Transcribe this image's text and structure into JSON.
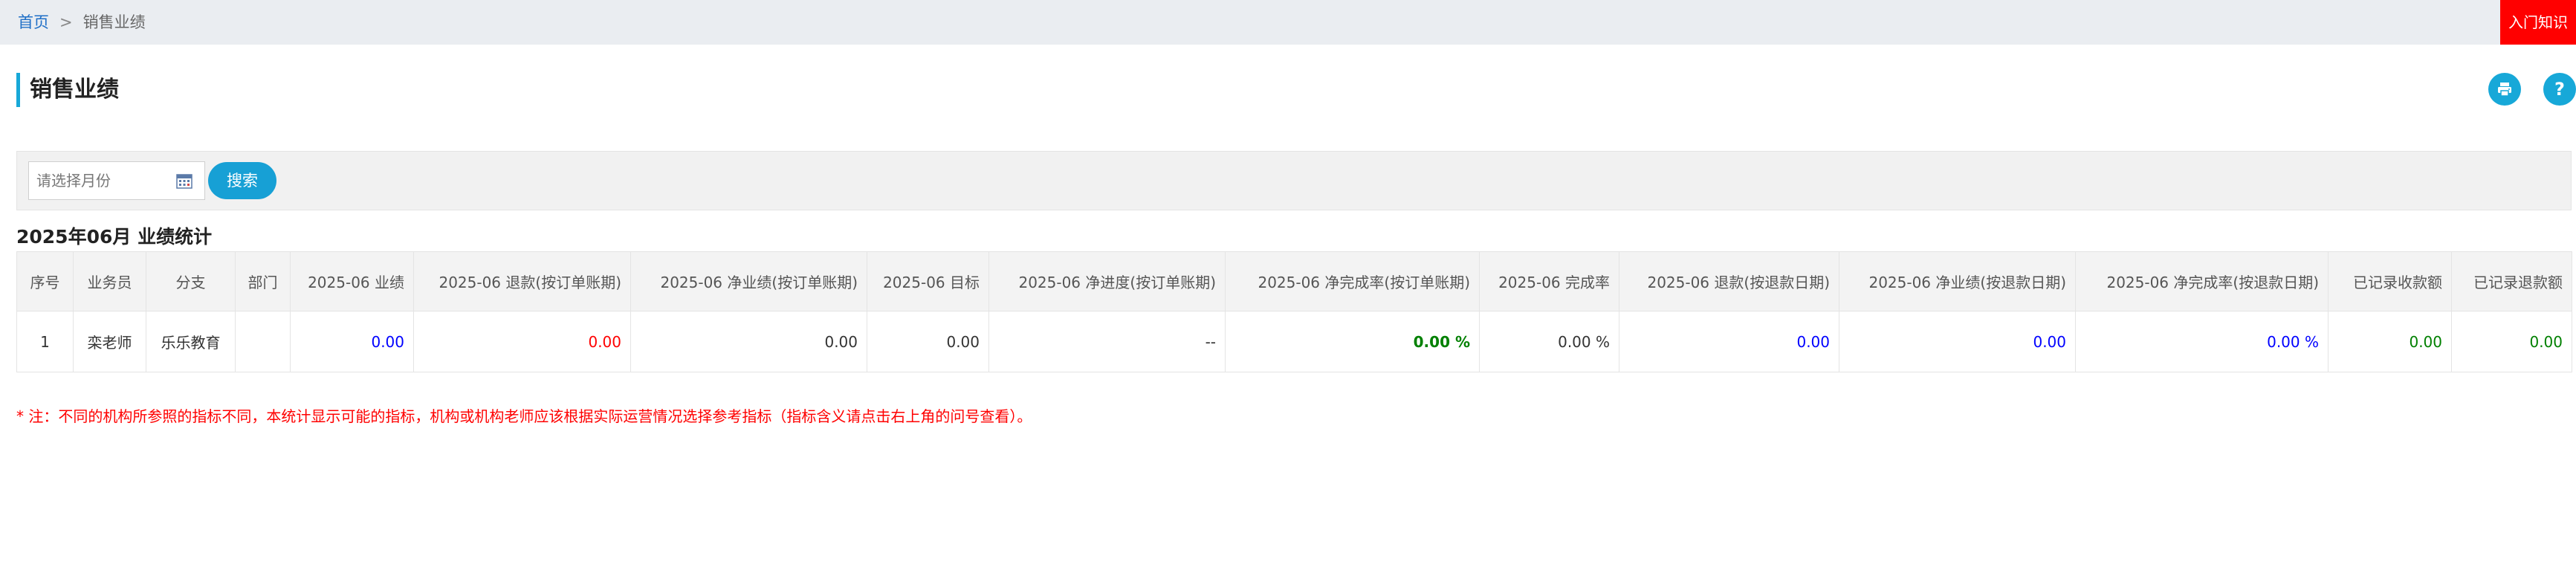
{
  "breadcrumb": {
    "home": "首页",
    "separator": ">",
    "current": "销售业绩"
  },
  "intro_button": "入门知识",
  "page_title": "销售业绩",
  "header_icons": {
    "print": "print-icon",
    "help": "?"
  },
  "search": {
    "placeholder": "请选择月份",
    "value": "",
    "button": "搜索",
    "calendar_icon": "calendar-icon"
  },
  "stats_title": "2025年06月 业绩统计",
  "table": {
    "headers": [
      "序号",
      "业务员",
      "分支",
      "部门",
      "2025-06 业绩",
      "2025-06 退款(按订单账期)",
      "2025-06 净业绩(按订单账期)",
      "2025-06 目标",
      "2025-06 净进度(按订单账期)",
      "2025-06 净完成率(按订单账期)",
      "2025-06 完成率",
      "2025-06 退款(按退款日期)",
      "2025-06 净业绩(按退款日期)",
      "2025-06 净完成率(按退款日期)",
      "已记录收款额",
      "已记录退款额"
    ],
    "rows": [
      [
        "1",
        "栾老师",
        "乐乐教育",
        "",
        "0.00",
        "0.00",
        "0.00",
        "0.00",
        "--",
        "0.00 %",
        "0.00 %",
        "0.00",
        "0.00",
        "0.00 %",
        "0.00",
        "0.00"
      ]
    ]
  },
  "colors": {
    "accent": "#17a8d8",
    "intro_bg": "#ff0000",
    "link": "#1f6fc7",
    "blue_value": "#0000ff",
    "red_value": "#ff0000",
    "green_value": "#008000"
  },
  "note": "* 注：不同的机构所参照的指标不同，本统计显示可能的指标，机构或机构老师应该根据实际运营情况选择参考指标（指标含义请点击右上角的问号查看）。"
}
